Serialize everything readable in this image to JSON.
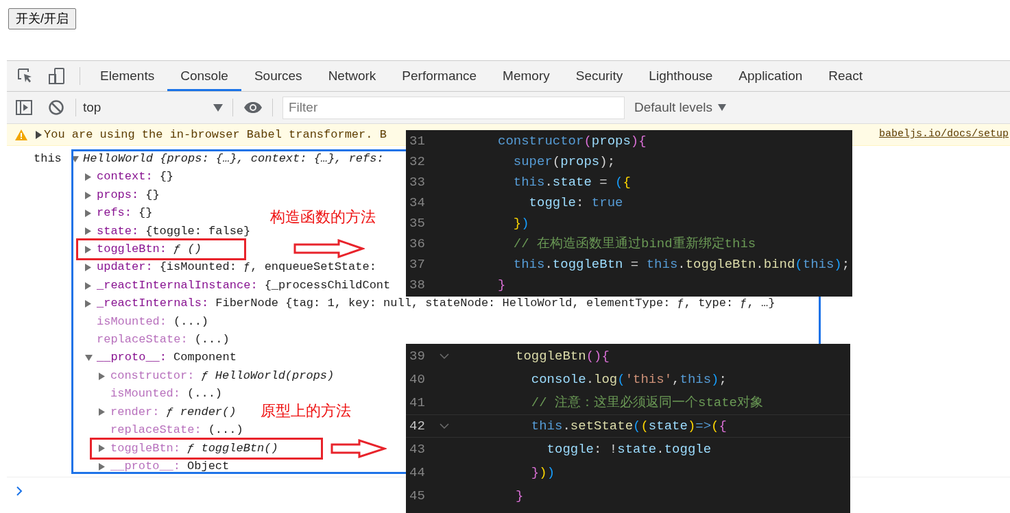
{
  "page_button": {
    "label": "开关/开启"
  },
  "devtools": {
    "tabs": [
      {
        "label": "Elements",
        "selected": false
      },
      {
        "label": "Console",
        "selected": true
      },
      {
        "label": "Sources",
        "selected": false
      },
      {
        "label": "Network",
        "selected": false
      },
      {
        "label": "Performance",
        "selected": false
      },
      {
        "label": "Memory",
        "selected": false
      },
      {
        "label": "Security",
        "selected": false
      },
      {
        "label": "Lighthouse",
        "selected": false
      },
      {
        "label": "Application",
        "selected": false
      },
      {
        "label": "React",
        "selected": false
      }
    ],
    "console_toolbar": {
      "context": "top",
      "filter_placeholder": "Filter",
      "levels": "Default levels"
    },
    "warning": {
      "text": "You are using the in-browser Babel transformer. B",
      "link": "babeljs.io/docs/setup"
    },
    "log": {
      "label": "this",
      "tree": [
        {
          "value": "HelloWorld {props: {…}, context: {…}, refs:",
          "expandable": true,
          "expanded": true,
          "dim": false,
          "italic": true,
          "boxed": false,
          "children": [
            {
              "key": "context:",
              "value": "{}",
              "expandable": true,
              "expanded": false,
              "dim": false,
              "italic": false,
              "boxed": false
            },
            {
              "key": "props:",
              "value": "{}",
              "expandable": true,
              "expanded": false,
              "dim": false,
              "italic": false,
              "boxed": false
            },
            {
              "key": "refs:",
              "value": "{}",
              "expandable": true,
              "expanded": false,
              "dim": false,
              "italic": false,
              "boxed": false
            },
            {
              "key": "state:",
              "value": "{toggle: false}",
              "expandable": true,
              "expanded": false,
              "dim": false,
              "italic": false,
              "boxed": false
            },
            {
              "key": "toggleBtn:",
              "value": "ƒ ()",
              "expandable": true,
              "expanded": false,
              "dim": false,
              "italic": true,
              "boxed": true
            },
            {
              "key": "updater:",
              "value": "{isMounted: ƒ, enqueueSetState:",
              "expandable": true,
              "expanded": false,
              "dim": false,
              "italic": false,
              "boxed": false
            },
            {
              "key": "_reactInternalInstance:",
              "value": "{_processChildCont",
              "expandable": true,
              "expanded": false,
              "dim": false,
              "italic": false,
              "boxed": false
            },
            {
              "key": "_reactInternals:",
              "value": "FiberNode {tag: 1, key: null, stateNode: HelloWorld, elementType: ƒ, type: ƒ, …}",
              "expandable": true,
              "expanded": false,
              "dim": false,
              "italic": false,
              "boxed": false
            },
            {
              "key": "isMounted:",
              "value": "(...)",
              "expandable": false,
              "expanded": false,
              "dim": true,
              "italic": false,
              "boxed": false
            },
            {
              "key": "replaceState:",
              "value": "(...)",
              "expandable": false,
              "expanded": false,
              "dim": true,
              "italic": false,
              "boxed": false
            },
            {
              "key": "__proto__:",
              "value": "Component",
              "expandable": true,
              "expanded": true,
              "dim": false,
              "italic": false,
              "boxed": false,
              "children": [
                {
                  "key": "constructor:",
                  "value": "ƒ HelloWorld(props)",
                  "expandable": true,
                  "expanded": false,
                  "dim": true,
                  "italic": true,
                  "boxed": false
                },
                {
                  "key": "isMounted:",
                  "value": "(...)",
                  "expandable": false,
                  "expanded": false,
                  "dim": true,
                  "italic": false,
                  "boxed": false
                },
                {
                  "key": "render:",
                  "value": "ƒ render()",
                  "expandable": true,
                  "expanded": false,
                  "dim": true,
                  "italic": true,
                  "boxed": false
                },
                {
                  "key": "replaceState:",
                  "value": "(...)",
                  "expandable": false,
                  "expanded": false,
                  "dim": true,
                  "italic": false,
                  "boxed": false
                },
                {
                  "key": "toggleBtn:",
                  "value": "ƒ toggleBtn()",
                  "expandable": true,
                  "expanded": false,
                  "dim": true,
                  "italic": true,
                  "boxed": true
                },
                {
                  "key": "__proto__:",
                  "value": "Object",
                  "expandable": true,
                  "expanded": false,
                  "dim": true,
                  "italic": false,
                  "boxed": false
                }
              ]
            }
          ]
        }
      ]
    }
  },
  "annotations": [
    {
      "text": "构造函数的方法"
    },
    {
      "text": "原型上的方法"
    }
  ],
  "code_panels": [
    {
      "lines": [
        {
          "number": "31",
          "fold": false,
          "current": false,
          "tokens": [
            {
              "text": "constructor",
              "kind": "kw"
            },
            {
              "text": "(",
              "kind": "b2"
            },
            {
              "text": "props",
              "kind": "var"
            },
            {
              "text": "){",
              "kind": "b2"
            }
          ]
        },
        {
          "number": "32",
          "fold": false,
          "current": false,
          "tokens": [
            {
              "text": "  super",
              "kind": "kw"
            },
            {
              "text": "(",
              "kind": "punc"
            },
            {
              "text": "props",
              "kind": "var"
            },
            {
              "text": ");",
              "kind": "punc"
            }
          ]
        },
        {
          "number": "33",
          "fold": false,
          "current": false,
          "tokens": [
            {
              "text": "  this",
              "kind": "kw"
            },
            {
              "text": ".",
              "kind": "punc"
            },
            {
              "text": "state",
              "kind": "var"
            },
            {
              "text": " = ",
              "kind": "punc"
            },
            {
              "text": "(",
              "kind": "b3"
            },
            {
              "text": "{",
              "kind": "b1"
            }
          ]
        },
        {
          "number": "34",
          "fold": false,
          "current": false,
          "tokens": [
            {
              "text": "    toggle",
              "kind": "var"
            },
            {
              "text": ": ",
              "kind": "punc"
            },
            {
              "text": "true",
              "kind": "kw"
            }
          ]
        },
        {
          "number": "35",
          "fold": false,
          "current": false,
          "tokens": [
            {
              "text": "  }",
              "kind": "b1"
            },
            {
              "text": ")",
              "kind": "b3"
            }
          ]
        },
        {
          "number": "36",
          "fold": false,
          "current": false,
          "tokens": [
            {
              "text": "  // 在构造函数里通过bind重新绑定this",
              "kind": "com"
            }
          ]
        },
        {
          "number": "37",
          "fold": false,
          "current": false,
          "tokens": [
            {
              "text": "  this",
              "kind": "kw"
            },
            {
              "text": ".",
              "kind": "punc"
            },
            {
              "text": "toggleBtn",
              "kind": "var"
            },
            {
              "text": " = ",
              "kind": "punc"
            },
            {
              "text": "this",
              "kind": "kw"
            },
            {
              "text": ".",
              "kind": "punc"
            },
            {
              "text": "toggleBtn",
              "kind": "fn"
            },
            {
              "text": ".",
              "kind": "punc"
            },
            {
              "text": "bind",
              "kind": "fn"
            },
            {
              "text": "(",
              "kind": "b3"
            },
            {
              "text": "this",
              "kind": "kw"
            },
            {
              "text": ")",
              "kind": "b3"
            },
            {
              "text": ";",
              "kind": "punc"
            }
          ]
        },
        {
          "number": "38",
          "fold": false,
          "current": false,
          "tokens": [
            {
              "text": "}",
              "kind": "b2"
            }
          ]
        }
      ]
    },
    {
      "lines": [
        {
          "number": "39",
          "fold": true,
          "current": false,
          "tokens": [
            {
              "text": "toggleBtn",
              "kind": "fn"
            },
            {
              "text": "(){",
              "kind": "b2"
            }
          ]
        },
        {
          "number": "40",
          "fold": false,
          "current": false,
          "tokens": [
            {
              "text": "  console",
              "kind": "var"
            },
            {
              "text": ".",
              "kind": "punc"
            },
            {
              "text": "log",
              "kind": "fn"
            },
            {
              "text": "(",
              "kind": "b3"
            },
            {
              "text": "'this'",
              "kind": "str"
            },
            {
              "text": ",",
              "kind": "punc"
            },
            {
              "text": "this",
              "kind": "kw"
            },
            {
              "text": ")",
              "kind": "b3"
            },
            {
              "text": ";",
              "kind": "punc"
            }
          ]
        },
        {
          "number": "41",
          "fold": false,
          "current": false,
          "tokens": [
            {
              "text": "  // 注意：这里必须返同一个state对象",
              "kind": "com"
            }
          ]
        },
        {
          "number": "42",
          "fold": true,
          "current": true,
          "tokens": [
            {
              "text": "  this",
              "kind": "kw"
            },
            {
              "text": ".",
              "kind": "punc"
            },
            {
              "text": "setState",
              "kind": "fn"
            },
            {
              "text": "(",
              "kind": "b3"
            },
            {
              "text": "(",
              "kind": "b1"
            },
            {
              "text": "state",
              "kind": "var"
            },
            {
              "text": ")",
              "kind": "b1"
            },
            {
              "text": "=>",
              "kind": "kw"
            },
            {
              "text": "(",
              "kind": "b1"
            },
            {
              "text": "{",
              "kind": "b2"
            }
          ]
        },
        {
          "number": "43",
          "fold": false,
          "current": false,
          "tokens": [
            {
              "text": "    toggle",
              "kind": "var"
            },
            {
              "text": ": !",
              "kind": "punc"
            },
            {
              "text": "state",
              "kind": "var"
            },
            {
              "text": ".",
              "kind": "punc"
            },
            {
              "text": "toggle",
              "kind": "var"
            }
          ]
        },
        {
          "number": "44",
          "fold": false,
          "current": false,
          "tokens": [
            {
              "text": "  }",
              "kind": "b2"
            },
            {
              "text": ")",
              "kind": "b1"
            },
            {
              "text": ")",
              "kind": "b3"
            }
          ]
        },
        {
          "number": "45",
          "fold": false,
          "current": false,
          "tokens": [
            {
              "text": "}",
              "kind": "b2"
            }
          ]
        }
      ]
    }
  ]
}
